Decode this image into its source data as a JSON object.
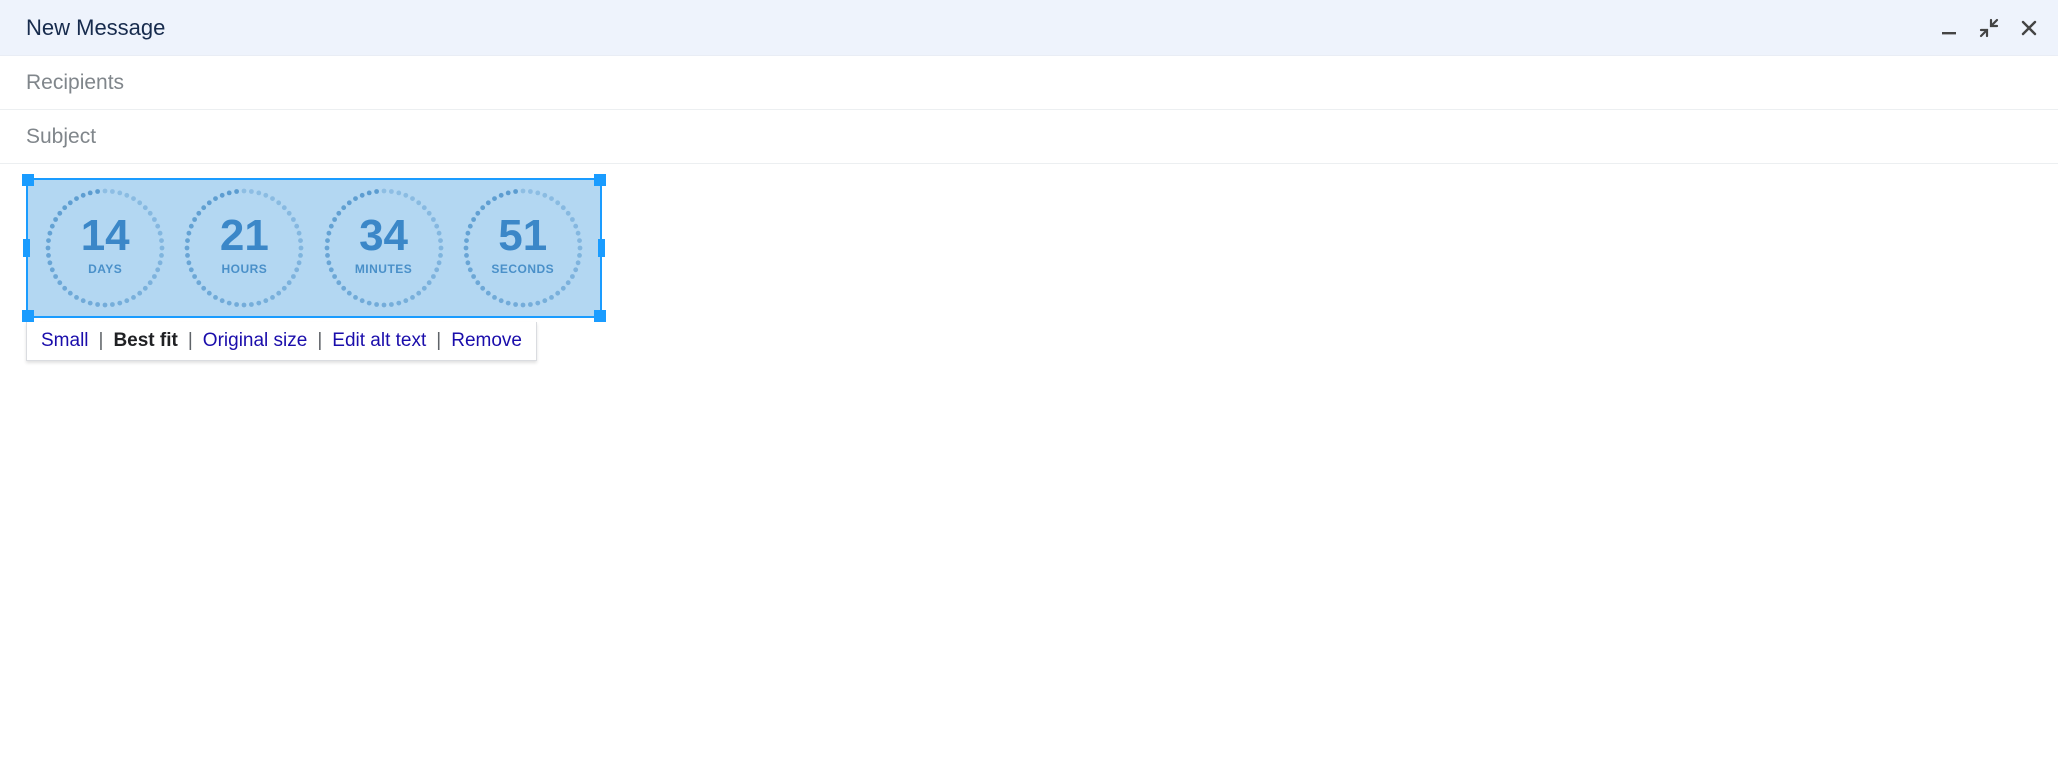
{
  "header": {
    "title": "New Message"
  },
  "fields": {
    "recipients_placeholder": "Recipients",
    "recipients_value": "",
    "subject_placeholder": "Subject",
    "subject_value": ""
  },
  "countdown": {
    "items": [
      {
        "value": "14",
        "label": "DAYS"
      },
      {
        "value": "21",
        "label": "HOURS"
      },
      {
        "value": "34",
        "label": "MINUTES"
      },
      {
        "value": "51",
        "label": "SECONDS"
      }
    ]
  },
  "image_toolbar": {
    "small": "Small",
    "best_fit": "Best fit",
    "original": "Original size",
    "edit_alt": "Edit alt text",
    "remove": "Remove",
    "separator": "|"
  }
}
